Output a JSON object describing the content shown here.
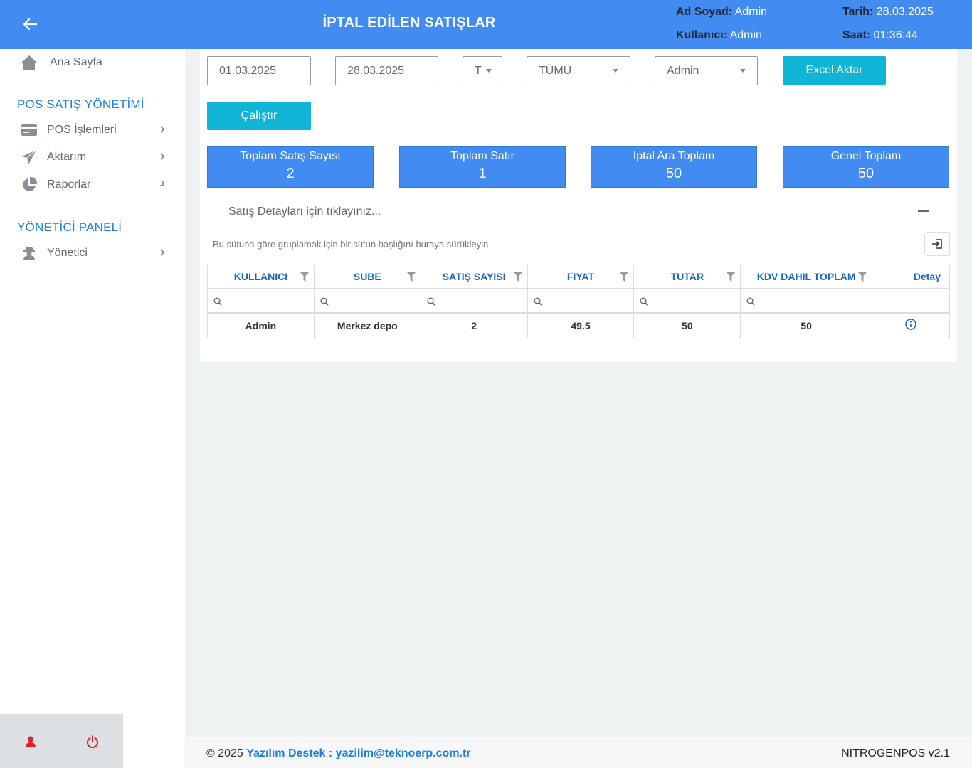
{
  "header": {
    "title": "İPTAL EDİLEN SATIŞLAR",
    "ad_soyad_label": "Ad Soyad:",
    "ad_soyad_value": "Admin",
    "kullanici_label": "Kullanıcı:",
    "kullanici_value": "Admin",
    "tarih_label": "Tarih:",
    "tarih_value": "28.03.2025",
    "saat_label": "Saat:",
    "saat_value": "01:36:44"
  },
  "sidebar": {
    "home_label": "Ana Sayfa",
    "section1": "POS SATIŞ YÖNETİMİ",
    "items1": [
      {
        "label": "POS İşlemleri",
        "icon": "credit-card-icon"
      },
      {
        "label": "Aktarım",
        "icon": "paper-plane-icon"
      },
      {
        "label": "Raporlar",
        "icon": "pie-chart-icon"
      }
    ],
    "section2": "YÖNETİCİ PANELİ",
    "items2": [
      {
        "label": "Yönetici",
        "icon": "user-secret-icon"
      }
    ]
  },
  "filters": {
    "start_date": "01.03.2025",
    "end_date": "28.03.2025",
    "small_select": "T",
    "type_select": "TÜMÜ",
    "user_select": "Admin",
    "excel_label": "Excel Aktar",
    "run_label": "Çalıştır"
  },
  "stats": [
    {
      "label": "Toplam Satış Sayısı",
      "value": "2"
    },
    {
      "label": "Toplam Satır",
      "value": "1"
    },
    {
      "label": "Iptal Ara Toplam",
      "value": "50"
    },
    {
      "label": "Genel Toplam",
      "value": "50"
    }
  ],
  "details_toggle": "Satış Detayları için tıklayınız...",
  "group_hint": "Bu sütuna göre gruplamak için bir sütun başlığını buraya sürükleyin",
  "grid": {
    "columns": [
      "KULLANICI",
      "SUBE",
      "SATIŞ SAYISI",
      "FIYAT",
      "TUTAR",
      "KDV DAHIL TOPLAM",
      "Detay"
    ],
    "rows": [
      [
        "Admin",
        "Merkez depo",
        "2",
        "49.5",
        "50",
        "50"
      ]
    ]
  },
  "footer": {
    "copyright": "© 2025 ",
    "support": "Yazılım Destek : yazilim@teknoerp.com.tr",
    "version": "NITROGENPOS v2.1"
  },
  "colors": {
    "header": "#418bf1",
    "accent": "#10b5d6",
    "section": "#1a7ee6",
    "power": "#e02020"
  }
}
